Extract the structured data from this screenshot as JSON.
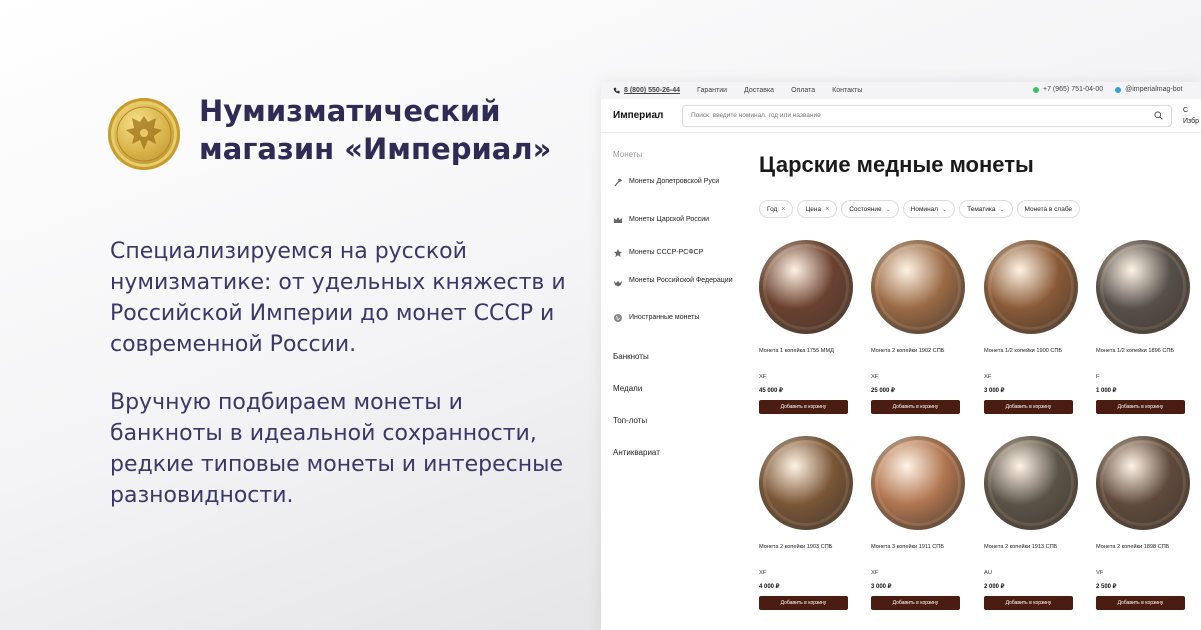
{
  "promo": {
    "title": "Нумизматический магазин «Империал»",
    "paragraph1": "Специализируемся на русской нумизматике: от удельных княжеств и Российской Империи до монет СССР и современной России.",
    "paragraph2": "Вручную подбираем монеты и банкноты в идеальной сохранности, редкие типовые монеты и интересные разновидности."
  },
  "topbar": {
    "phone": "8 (800) 550-26-44",
    "links": [
      "Гарантии",
      "Доставка",
      "Оплата",
      "Контакты"
    ],
    "whatsapp": "+7 (965) 751-04-00",
    "telegram": "@imperialmag-bot"
  },
  "header": {
    "brand": "Империал",
    "search_placeholder": "Поиск: введите номинал, год или название",
    "fav_top": "С",
    "fav_label": "Избр"
  },
  "sidebar": {
    "heading": "Монеты",
    "coin_items": [
      {
        "label": "Монеты Допетровской Руси",
        "icon": "axe-icon"
      },
      {
        "label": "Монеты Царской России",
        "icon": "crown-icon"
      },
      {
        "label": "Монеты СССР-РСФСР",
        "icon": "star-icon"
      },
      {
        "label": "Монеты Российской Федерации",
        "icon": "eagle-icon"
      },
      {
        "label": "Иностранные монеты",
        "icon": "globe-icon"
      }
    ],
    "sections": [
      "Банкноты",
      "Медали",
      "Топ-лоты",
      "Антиквариат"
    ]
  },
  "content": {
    "title": "Царские медные монеты",
    "filters": [
      {
        "label": "Год",
        "mark": "×"
      },
      {
        "label": "Цена",
        "mark": "×"
      },
      {
        "label": "Состояние",
        "mark": "⌄"
      },
      {
        "label": "Номинал",
        "mark": "⌄"
      },
      {
        "label": "Тематика",
        "mark": "⌄"
      },
      {
        "label": "Монета в слабе",
        "mark": ""
      }
    ],
    "buy_label": "Добавить в корзину",
    "products": [
      {
        "name": "Монета 1 копейка 1755 ММД",
        "grade": "XF",
        "price": "45 000 ₽",
        "coin_color": "#6b4130"
      },
      {
        "name": "Монета 2 копейки 1902 СПБ",
        "grade": "XF",
        "price": "25 000 ₽",
        "coin_color": "#9a6a45"
      },
      {
        "name": "Монета 1/2 копейки 1900 СПБ",
        "grade": "XF",
        "price": "3 000 ₽",
        "coin_color": "#8a5a37"
      },
      {
        "name": "Монета 1/2 копейки 1896 СПБ",
        "grade": "F",
        "price": "1 000 ₽",
        "coin_color": "#56504a"
      },
      {
        "name": "Монета 2 копейки 1903 СПБ",
        "grade": "XF",
        "price": "4 000 ₽",
        "coin_color": "#7a5636"
      },
      {
        "name": "Монета 3 копейки 1911 СПБ",
        "grade": "XF",
        "price": "3 000 ₽",
        "coin_color": "#b07550"
      },
      {
        "name": "Монета 2 копейки 1913 СПБ",
        "grade": "AU",
        "price": "2 000 ₽",
        "coin_color": "#5a5448"
      },
      {
        "name": "Монета 2 копейки 1898 СПБ",
        "grade": "VF",
        "price": "2 500 ₽",
        "coin_color": "#5f4a3c"
      }
    ]
  }
}
